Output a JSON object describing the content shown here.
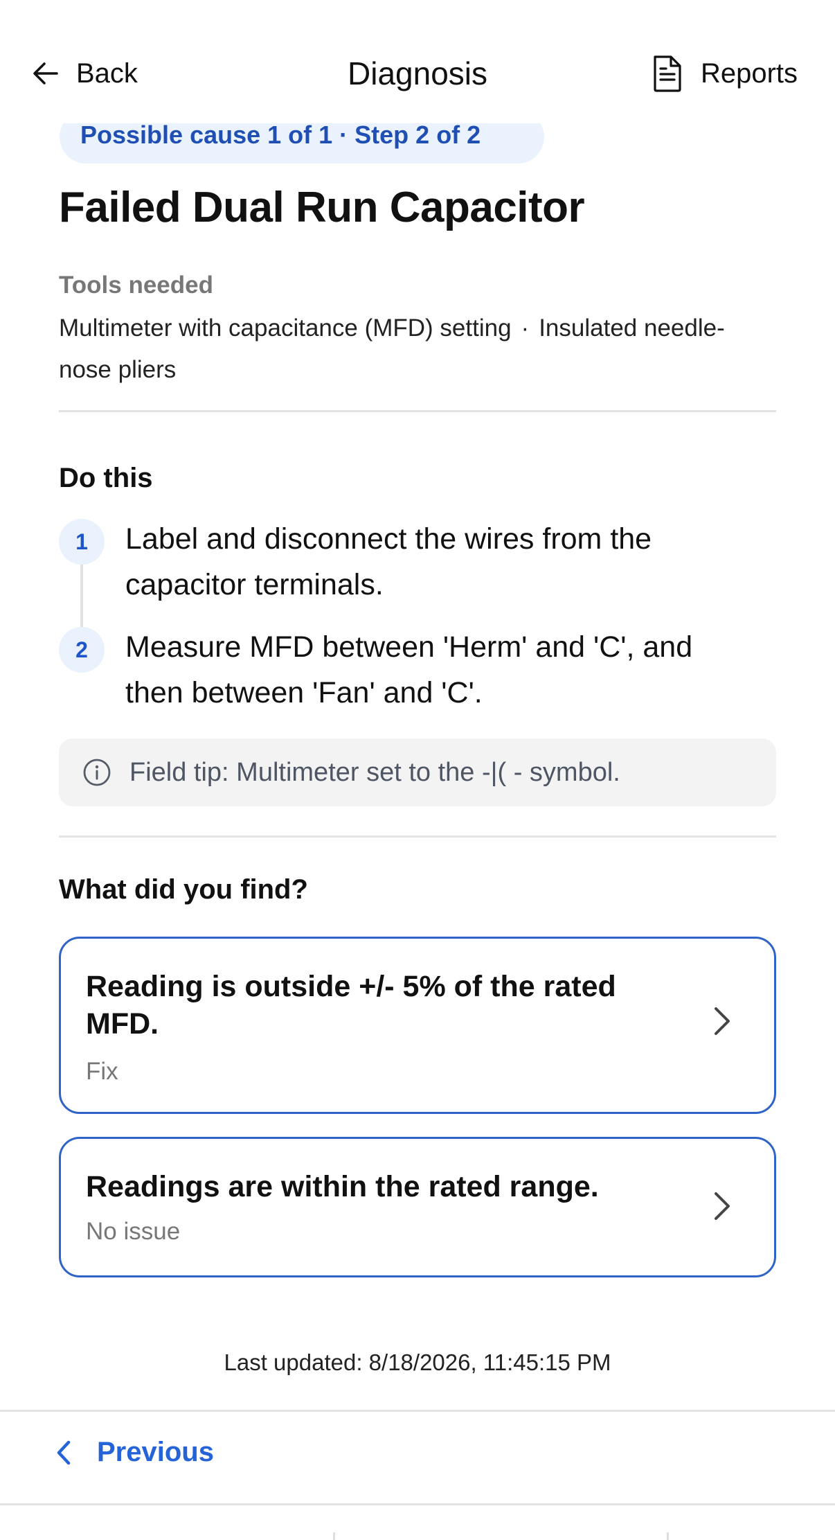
{
  "header": {
    "back_label": "Back",
    "title": "Diagnosis",
    "reports_label": "Reports"
  },
  "progress_pill": "Possible cause 1 of 1 · Step 2 of 2",
  "cause_title": "Failed Dual Run Capacitor",
  "tools": {
    "label": "Tools needed",
    "items": [
      "Multimeter with capacitance (MFD) setting",
      "Insulated needle-nose pliers"
    ],
    "separator": "·"
  },
  "instructions": {
    "label": "Do this",
    "steps": [
      {
        "number": "1",
        "text": "Label and disconnect the wires from the capacitor terminals."
      },
      {
        "number": "2",
        "text": "Measure MFD between 'Herm' and 'C', and then between 'Fan' and 'C'."
      }
    ],
    "tip": "Field tip: Multimeter set to the -|( - symbol."
  },
  "findings": {
    "label": "What did you find?",
    "options": [
      {
        "title": "Reading is outside +/- 5% of the rated MFD.",
        "subtitle": "Fix"
      },
      {
        "title": "Readings are within the rated range.",
        "subtitle": "No issue"
      }
    ]
  },
  "last_updated": "Last updated: 8/18/2026, 11:45:15 PM",
  "footer": {
    "previous_label": "Previous"
  },
  "colors": {
    "accent": "#2563d8",
    "card_border": "#2f63c7",
    "pill_bg": "#eaf3fd",
    "step_badge_bg": "#e8f1fc",
    "tip_bg": "#f3f3f4"
  },
  "icons": [
    "arrow-left-icon",
    "document-icon",
    "step-badge",
    "info-icon",
    "chevron-right-icon",
    "chevron-left-icon"
  ]
}
